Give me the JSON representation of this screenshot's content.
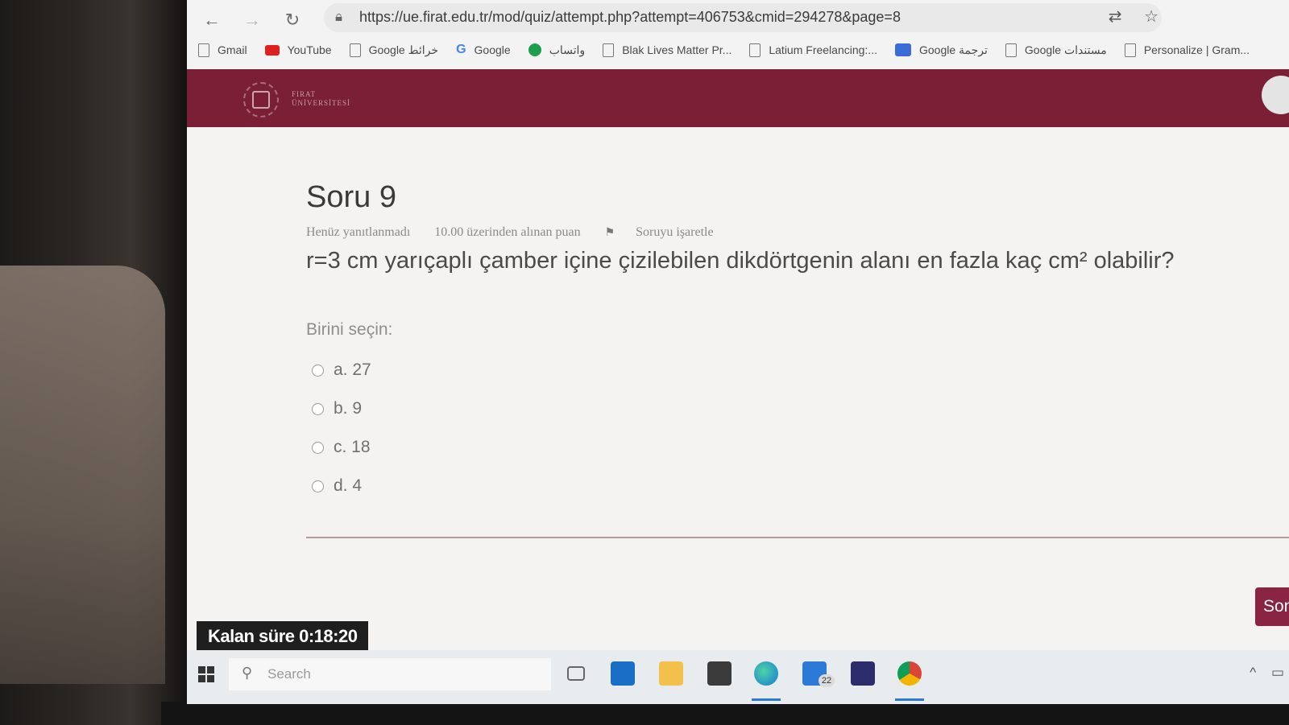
{
  "browser": {
    "url": "https://ue.firat.edu.tr/mod/quiz/attempt.php?attempt=406753&cmid=294278&page=8",
    "bookmarks": [
      {
        "label": "Gmail",
        "icon": "page-icon"
      },
      {
        "label": "YouTube",
        "icon": "youtube-icon"
      },
      {
        "label": "Google خرائط",
        "icon": "page-icon"
      },
      {
        "label": "Google",
        "icon": "google-icon"
      },
      {
        "label": "واتساب",
        "icon": "whatsapp-icon"
      },
      {
        "label": "Blak Lives Matter Pr...",
        "icon": "page-icon"
      },
      {
        "label": "Latium Freelancing:...",
        "icon": "page-icon"
      },
      {
        "label": "Google ترجمة",
        "icon": "translate-icon"
      },
      {
        "label": "Google مستندات",
        "icon": "page-icon"
      },
      {
        "label": "Personalize | Gram...",
        "icon": "page-icon"
      }
    ]
  },
  "site": {
    "logo_text": "FIRAT\nÜNİVERSİTESİ"
  },
  "question": {
    "title": "Soru 9",
    "status": "Henüz yanıtlanmadı",
    "points": "10.00 üzerinden alınan puan",
    "flag_label": "Soruyu işaretle",
    "text": "r=3 cm yarıçaplı çamber içine çizilebilen dikdörtgenin alanı en fazla kaç cm² olabilir?",
    "prompt": "Birini seçin:",
    "options": [
      {
        "label": "a. 27",
        "selected": false
      },
      {
        "label": "b. 9",
        "selected": false
      },
      {
        "label": "c. 18",
        "selected": false
      },
      {
        "label": "d. 4",
        "selected": false
      }
    ]
  },
  "footer": {
    "next_label": "Son",
    "timer_label": "Kalan süre 0:18:20"
  },
  "taskbar": {
    "search_placeholder": "Search",
    "mail_badge": "22"
  },
  "colors": {
    "header": "#7a1f36",
    "next_button": "#8a2443"
  }
}
